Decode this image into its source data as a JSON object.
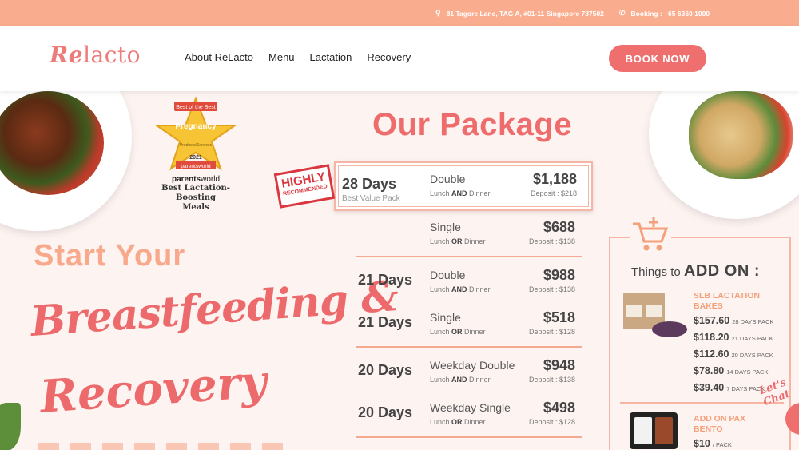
{
  "topbar": {
    "address": "81 Tagore Lane, TAG A, #01-11 Singapore 787502",
    "booking": "Booking : +65 6360 1000",
    "color": "#f9ad8e"
  },
  "header": {
    "logo_re": "Re",
    "logo_rest": "lacto",
    "nav": [
      "About ReLacto",
      "Menu",
      "Lactation",
      "Recovery"
    ],
    "book_now": "BOOK NOW",
    "accent": "#ef6e6e"
  },
  "award": {
    "ribbon": "Best of the Best",
    "star_text": "Pregnancy",
    "star_sub": "Products/Services",
    "year": "2021",
    "banner": "parentsworld",
    "brand_bold": "parents",
    "brand_light": "world",
    "caption_line1": "Best Lactation-Boosting",
    "caption_line2": "Meals"
  },
  "hero": {
    "start": "Start Your",
    "script_line1": "Breastfeeding &",
    "script_line2": "Recovery"
  },
  "package": {
    "title": "Our Package",
    "stamp_top": "HIGHLY",
    "stamp_bottom": "RECOMMENDED",
    "rows": [
      {
        "days": "28 Days",
        "sub": "Best Value Pack",
        "type": "Double",
        "meal_a": "Lunch ",
        "meal_conj": "AND",
        "meal_b": " Dinner",
        "price": "$1,188",
        "deposit": "Deposit : $218"
      },
      {
        "days": "",
        "sub": "",
        "type": "Single",
        "meal_a": "Lunch ",
        "meal_conj": "OR",
        "meal_b": " Dinner",
        "price": "$688",
        "deposit": "Deposit : $138"
      },
      {
        "days": "21 Days",
        "sub": "",
        "type": "Double",
        "meal_a": "Lunch ",
        "meal_conj": "AND",
        "meal_b": " Dinner",
        "price": "$988",
        "deposit": "Deposit : $138"
      },
      {
        "days": "21 Days",
        "sub": "",
        "type": "Single",
        "meal_a": "Lunch ",
        "meal_conj": "OR",
        "meal_b": " Dinner",
        "price": "$518",
        "deposit": "Deposit : $128"
      },
      {
        "days": "20 Days",
        "sub": "",
        "type": "Weekday Double",
        "meal_a": "Lunch ",
        "meal_conj": "AND",
        "meal_b": " Dinner",
        "price": "$948",
        "deposit": "Deposit : $138"
      },
      {
        "days": "20 Days",
        "sub": "",
        "type": "Weekday Single",
        "meal_a": "Lunch ",
        "meal_conj": "OR",
        "meal_b": " Dinner",
        "price": "$498",
        "deposit": "Deposit : $128"
      }
    ]
  },
  "addon": {
    "things_prefix": "Things to ",
    "things_bold": "ADD ON :",
    "slb_title_1": "SLB LACTATION",
    "slb_title_2": "BAKES",
    "slb_prices": [
      {
        "price": "$157.60",
        "pack": "28 DAYS PACK"
      },
      {
        "price": "$118.20",
        "pack": "21 DAYS PACK"
      },
      {
        "price": "$112.60",
        "pack": "20 DAYS PACK"
      },
      {
        "price": "$78.80",
        "pack": "14 DAYS PACK"
      },
      {
        "price": "$39.40",
        "pack": "7 DAYS PACK"
      }
    ],
    "bento_title_1": "ADD ON PAX",
    "bento_title_2": "BENTO",
    "bento_price": "$10",
    "bento_unit": "/ PACK"
  },
  "chat": {
    "label": "Let's Chat"
  }
}
